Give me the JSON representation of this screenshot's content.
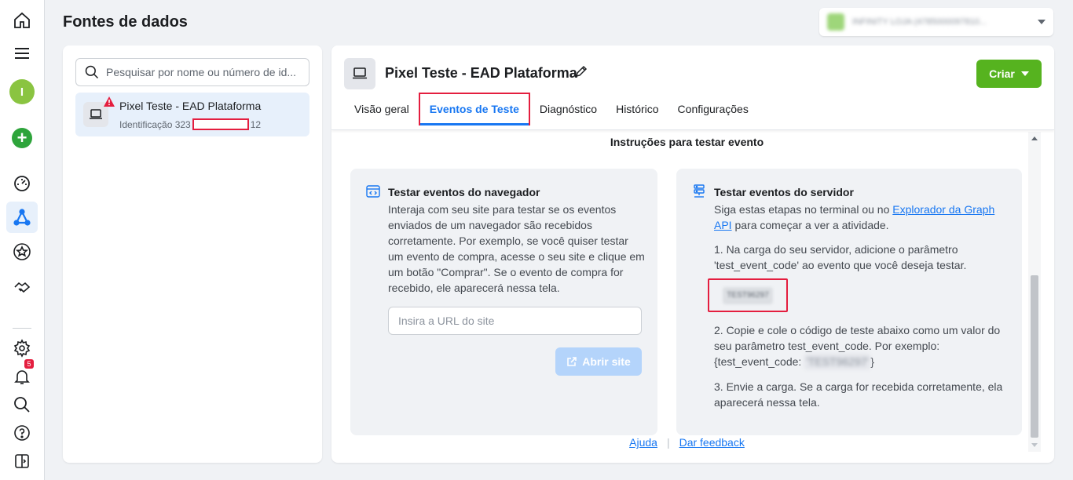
{
  "header": {
    "title": "Fontes de dados",
    "account_name": "INFINITY LOJA (4785000097810...",
    "account_accent": "#9ed67a"
  },
  "rail": {
    "avatar_letter": "I",
    "notifications_count": "5",
    "icons": [
      "home-icon",
      "menu-icon",
      "avatar",
      "create-icon",
      "dashboard-icon",
      "events-manager-icon",
      "star-icon",
      "handshake-icon",
      "settings-icon",
      "notifications-icon",
      "search-icon",
      "help-icon",
      "panel-toggle-icon"
    ]
  },
  "left_panel": {
    "search_placeholder": "Pesquisar por nome ou número de id...",
    "datasource": {
      "name": "Pixel Teste - EAD Plataforma",
      "id_prefix": "Identificação 323",
      "id_suffix": "12"
    }
  },
  "main": {
    "pixel_title": "Pixel Teste - EAD Plataforma",
    "create_label": "Criar",
    "tabs": [
      {
        "label": "Visão geral"
      },
      {
        "label": "Eventos de Teste"
      },
      {
        "label": "Diagnóstico"
      },
      {
        "label": "Histórico"
      },
      {
        "label": "Configurações"
      }
    ],
    "section_title": "Instruções para testar evento",
    "browser_card": {
      "title": "Testar eventos do navegador",
      "text": "Interaja com seu site para testar se os eventos enviados de um navegador são recebidos corretamente. Por exemplo, se você quiser testar um evento de compra, acesse o seu site e clique em um botão \"Comprar\". Se o evento de compra for recebido, ele aparecerá nessa tela.",
      "url_placeholder": "Insira a URL do site",
      "open_label": "Abrir site"
    },
    "server_card": {
      "title": "Testar eventos do servidor",
      "intro_before": "Siga estas etapas no terminal ou no ",
      "intro_link": "Explorador da Graph API",
      "intro_after": " para começar a ver a atividade.",
      "step1": "1. Na carga do seu servidor, adicione o parâmetro 'test_event_code' ao evento que você deseja testar.",
      "test_code": "TEST96297",
      "step2": "2. Copie e cole o código de teste abaixo como um valor do seu parâmetro test_event_code. Por exemplo:",
      "example_prefix": "{test_event_code: ",
      "example_code": "'TEST96297'",
      "example_suffix": "}",
      "step3": "3. Envie a carga. Se a carga for recebida corretamente, ela aparecerá nessa tela."
    },
    "footer": {
      "help": "Ajuda",
      "feedback": "Dar feedback"
    }
  },
  "colors": {
    "primary": "#1877f2",
    "create_green": "#56b31f",
    "highlight_red": "#e41e3f"
  }
}
